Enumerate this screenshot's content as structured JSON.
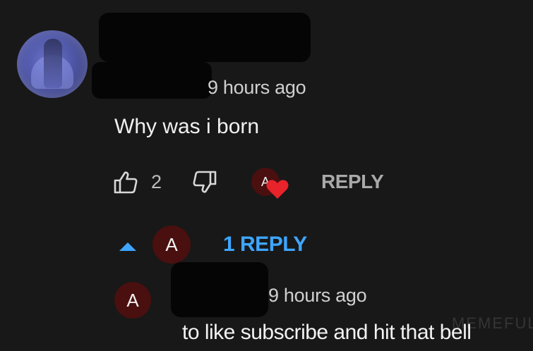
{
  "comment": {
    "timestamp": "9 hours ago",
    "text": "Why was i born",
    "like_count": "2",
    "reply_label": "REPLY",
    "heart_avatar_letter": "A"
  },
  "replies_toggle": {
    "avatar_letter": "A",
    "label": "1 REPLY"
  },
  "reply": {
    "avatar_letter": "A",
    "timestamp": "9 hours ago",
    "text": "to like subscribe and hit that bell"
  },
  "watermark": "MEMEFUL",
  "colors": {
    "background": "#181818",
    "link_blue": "#3ea6ff",
    "heart_red": "#e8232b",
    "avatar_dark_red": "#4a0f0f"
  },
  "icons": [
    "like-icon",
    "dislike-icon",
    "heart-icon",
    "caret-up-icon"
  ]
}
